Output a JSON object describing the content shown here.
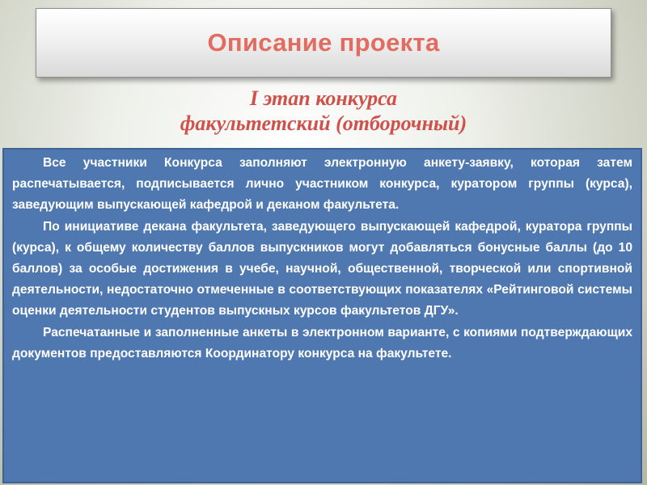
{
  "slide": {
    "title": "Описание проекта",
    "subtitle_line1": "I этап конкурса",
    "subtitle_line2": "факультетский (отборочный)",
    "paragraphs": [
      "Все участники Конкурса заполняют электронную анкету-заявку, которая затем распечатывается, подписывается лично участником конкурса, куратором группы (курса), заведующим выпускающей кафедрой и деканом факультета.",
      "По инициативе декана факультета, заведующего выпускающей кафедрой, куратора группы (курса), к общему количеству баллов выпускников могут добавляться бонусные баллы (до 10 баллов) за особые достижения в учебе, научной, общественной, творческой или спортивной деятельности, недостаточно отмеченные в соответствующих показателях «Рейтинговой системы оценки деятельности студентов выпускных курсов факультетов ДГУ».",
      "Распечатанные и заполненные анкеты в электронном варианте, с копиями подтверждающих документов предоставляются Координатору конкурса на факультете."
    ]
  },
  "colors": {
    "title": "#e36c60",
    "subtitle": "#d0504a",
    "content_background": "#4f78b1",
    "content_text": "#ffffff"
  }
}
